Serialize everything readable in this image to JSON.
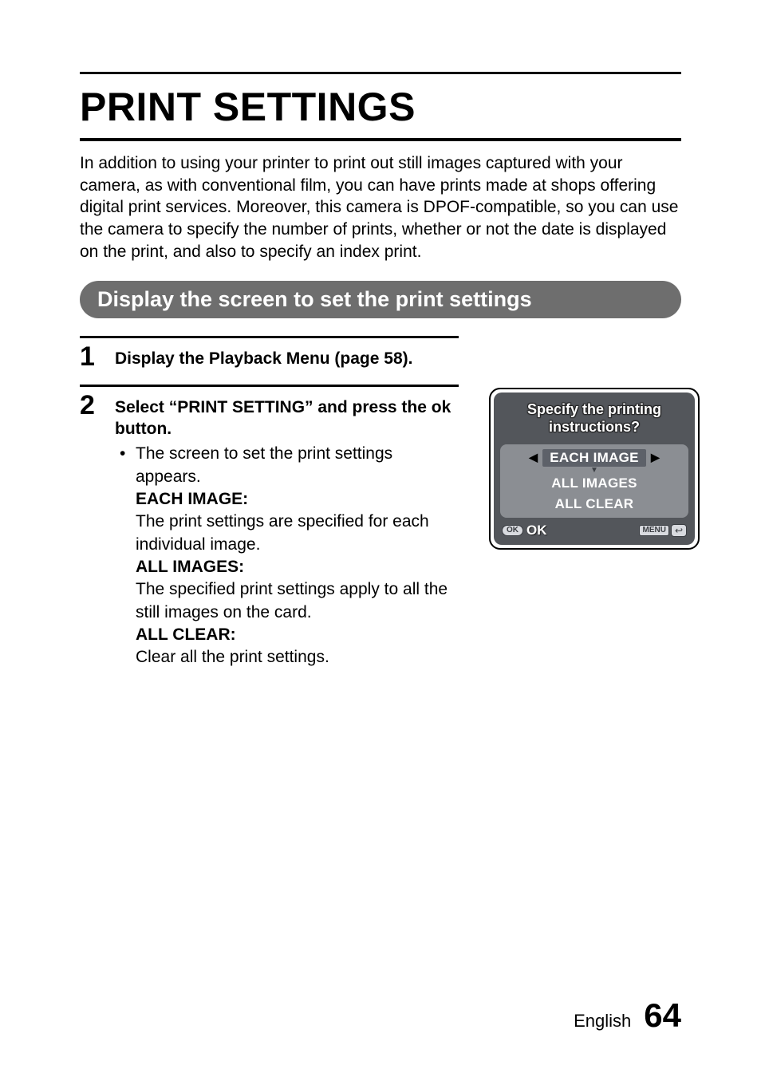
{
  "title": "PRINT SETTINGS",
  "intro": "In addition to using your printer to print out still images captured with your camera, as with conventional film, you can have prints made at shops offering digital print services. Moreover, this camera is DPOF-compatible, so you can use the camera to specify the number of prints, whether or not the date is displayed on the print, and also to specify an index print.",
  "section_heading": "Display the screen to set the print settings",
  "steps": {
    "one": {
      "number": "1",
      "heading": "Display the Playback Menu (page 58)."
    },
    "two": {
      "number": "2",
      "heading": "Select “PRINT SETTING” and press the ok button.",
      "bullet": "•",
      "bullet_text": "The screen to set the print settings appears.",
      "each_image_label": "EACH IMAGE:",
      "each_image_desc": "The print settings are specified for each individual image.",
      "all_images_label": "ALL IMAGES:",
      "all_images_desc": "The specified print settings apply to all the still images on the card.",
      "all_clear_label": "ALL CLEAR:",
      "all_clear_desc": "Clear all the print settings."
    }
  },
  "camera": {
    "title_line1": "Specify the printing",
    "title_line2": "instructions?",
    "option1": "EACH IMAGE",
    "option2": "ALL IMAGES",
    "option3": "ALL CLEAR",
    "ok_pill": "OK",
    "ok_text": "OK",
    "menu_label": "MENU"
  },
  "footer": {
    "lang": "English",
    "page": "64"
  }
}
